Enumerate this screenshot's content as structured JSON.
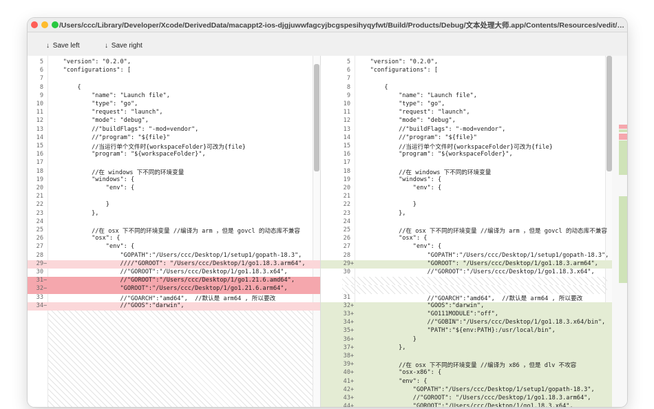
{
  "window": {
    "title": "/Users/ccc/Library/Developer/Xcode/DerivedData/macappt2-ios-djgjuwwfagcyjbcgspesihyqyfwt/Build/Products/Debug/文本处理大师.app/Contents/Resources/vedit/sample/ver1/launch.json..."
  },
  "toolbar": {
    "save_left_label": "Save left",
    "save_right_label": "Save right",
    "arrow_glyph": "↓"
  },
  "merge_arrow": "→",
  "colors": {
    "deleted": "#fbd7d9",
    "deleted_strong": "#f5a7ad",
    "added": "#e4ecd4",
    "minimap_red": "#f5a7ad",
    "minimap_green": "#cfe3b8"
  },
  "left_lines": [
    {
      "n": "5",
      "m": "",
      "t": "    \"version\": \"0.2.0\",",
      "s": ""
    },
    {
      "n": "6",
      "m": "",
      "t": "    \"configurations\": [",
      "s": ""
    },
    {
      "n": "7",
      "m": "",
      "t": "",
      "s": ""
    },
    {
      "n": "8",
      "m": "",
      "t": "        {",
      "s": ""
    },
    {
      "n": "9",
      "m": "",
      "t": "            \"name\": \"Launch file\",",
      "s": ""
    },
    {
      "n": "10",
      "m": "",
      "t": "            \"type\": \"go\",",
      "s": ""
    },
    {
      "n": "11",
      "m": "",
      "t": "            \"request\": \"launch\",",
      "s": ""
    },
    {
      "n": "12",
      "m": "",
      "t": "            \"mode\": \"debug\",",
      "s": ""
    },
    {
      "n": "13",
      "m": "",
      "t": "            //\"buildFlags\": \"-mod=vendor\",",
      "s": ""
    },
    {
      "n": "14",
      "m": "",
      "t": "            //\"program\": \"${file}\"",
      "s": ""
    },
    {
      "n": "15",
      "m": "",
      "t": "            //当运行单个文件时{workspaceFolder}可改为{file}",
      "s": ""
    },
    {
      "n": "16",
      "m": "",
      "t": "            \"program\": \"${workspaceFolder}\",",
      "s": ""
    },
    {
      "n": "17",
      "m": "",
      "t": "",
      "s": ""
    },
    {
      "n": "18",
      "m": "",
      "t": "            //在 windows 下不同的环境变量",
      "s": ""
    },
    {
      "n": "19",
      "m": "",
      "t": "            \"windows\": {",
      "s": ""
    },
    {
      "n": "20",
      "m": "",
      "t": "                \"env\": {",
      "s": ""
    },
    {
      "n": "21",
      "m": "",
      "t": "",
      "s": ""
    },
    {
      "n": "22",
      "m": "",
      "t": "                }",
      "s": ""
    },
    {
      "n": "23",
      "m": "",
      "t": "            },",
      "s": ""
    },
    {
      "n": "24",
      "m": "",
      "t": "",
      "s": ""
    },
    {
      "n": "25",
      "m": "",
      "t": "            //在 osx 下不同的环境变量 //编译为 arm ，但是 govcl 的动态库不兼容",
      "s": ""
    },
    {
      "n": "26",
      "m": "",
      "t": "            \"osx\": {",
      "s": ""
    },
    {
      "n": "27",
      "m": "",
      "t": "                \"env\": {",
      "s": ""
    },
    {
      "n": "28",
      "m": "",
      "t": "                    \"GOPATH\":\"/Users/ccc/Desktop/1/setup1/gopath-18.3\",",
      "s": ""
    },
    {
      "n": "29",
      "m": "−",
      "t": "                    ////\"GOROOT\": \"/Users/ccc/Desktop/1/go1.18.3.arm64\",",
      "s": "del"
    },
    {
      "n": "30",
      "m": "",
      "t": "                    //\"GOROOT\":\"/Users/ccc/Desktop/1/go1.18.3.x64\",",
      "s": ""
    },
    {
      "n": "31",
      "m": "−",
      "t": "                    //\"GOROOT\":\"/Users/ccc/Desktop/1/go1.21.6.amd64\",",
      "s": "delstrong"
    },
    {
      "n": "32",
      "m": "−",
      "t": "                    \"GOROOT\":\"/Users/ccc/Desktop/1/go1.21.6.arm64\",",
      "s": "delstrong"
    },
    {
      "n": "33",
      "m": "",
      "t": "                    //\"GOARCH\":\"amd64\",  //默认是 arm64 , 所以要改",
      "s": ""
    },
    {
      "n": "34",
      "m": "−",
      "t": "                    //\"GOOS\":\"darwin\",",
      "s": "del"
    }
  ],
  "right_lines": [
    {
      "n": "5",
      "m": "",
      "t": "    \"version\": \"0.2.0\",",
      "s": ""
    },
    {
      "n": "6",
      "m": "",
      "t": "    \"configurations\": [",
      "s": ""
    },
    {
      "n": "7",
      "m": "",
      "t": "",
      "s": ""
    },
    {
      "n": "8",
      "m": "",
      "t": "        {",
      "s": ""
    },
    {
      "n": "9",
      "m": "",
      "t": "            \"name\": \"Launch file\",",
      "s": ""
    },
    {
      "n": "10",
      "m": "",
      "t": "            \"type\": \"go\",",
      "s": ""
    },
    {
      "n": "11",
      "m": "",
      "t": "            \"request\": \"launch\",",
      "s": ""
    },
    {
      "n": "12",
      "m": "",
      "t": "            \"mode\": \"debug\",",
      "s": ""
    },
    {
      "n": "13",
      "m": "",
      "t": "            //\"buildFlags\": \"-mod=vendor\",",
      "s": ""
    },
    {
      "n": "14",
      "m": "",
      "t": "            //\"program\": \"${file}\"",
      "s": ""
    },
    {
      "n": "15",
      "m": "",
      "t": "            //当运行单个文件时{workspaceFolder}可改为{file}",
      "s": ""
    },
    {
      "n": "16",
      "m": "",
      "t": "            \"program\": \"${workspaceFolder}\",",
      "s": ""
    },
    {
      "n": "17",
      "m": "",
      "t": "",
      "s": ""
    },
    {
      "n": "18",
      "m": "",
      "t": "            //在 windows 下不同的环境变量",
      "s": ""
    },
    {
      "n": "19",
      "m": "",
      "t": "            \"windows\": {",
      "s": ""
    },
    {
      "n": "20",
      "m": "",
      "t": "                \"env\": {",
      "s": ""
    },
    {
      "n": "21",
      "m": "",
      "t": "",
      "s": ""
    },
    {
      "n": "22",
      "m": "",
      "t": "                }",
      "s": ""
    },
    {
      "n": "23",
      "m": "",
      "t": "            },",
      "s": ""
    },
    {
      "n": "24",
      "m": "",
      "t": "",
      "s": ""
    },
    {
      "n": "25",
      "m": "",
      "t": "            //在 osx 下不同的环境变量 //编译为 arm ，但是 govcl 的动态库不兼容",
      "s": ""
    },
    {
      "n": "26",
      "m": "",
      "t": "            \"osx\": {",
      "s": ""
    },
    {
      "n": "27",
      "m": "",
      "t": "                \"env\": {",
      "s": ""
    },
    {
      "n": "28",
      "m": "",
      "t": "                    \"GOPATH\":\"/Users/ccc/Desktop/1/setup1/gopath-18.3\",",
      "s": ""
    },
    {
      "n": "29",
      "m": "+",
      "t": "                    \"GOROOT\": \"/Users/ccc/Desktop/1/go1.18.3.arm64\",",
      "s": "add"
    },
    {
      "n": "30",
      "m": "",
      "t": "                    //\"GOROOT\":\"/Users/ccc/Desktop/1/go1.18.3.x64\",",
      "s": ""
    },
    {
      "n": "",
      "m": "",
      "t": "",
      "s": "gap"
    },
    {
      "n": "",
      "m": "",
      "t": "",
      "s": "gap"
    },
    {
      "n": "31",
      "m": "",
      "t": "                    //\"GOARCH\":\"amd64\",  //默认是 arm64 , 所以要改",
      "s": ""
    },
    {
      "n": "32",
      "m": "+",
      "t": "                    \"GOOS\":\"darwin\",",
      "s": "add"
    },
    {
      "n": "33",
      "m": "+",
      "t": "                    \"GO111MODULE\":\"off\",",
      "s": "add"
    },
    {
      "n": "34",
      "m": "+",
      "t": "                    //\"GOBIN\":\"/Users/ccc/Desktop/1/go1.18.3.x64/bin\",",
      "s": "add"
    },
    {
      "n": "35",
      "m": "+",
      "t": "                    \"PATH\":\"${env:PATH}:/usr/local/bin\",",
      "s": "add"
    },
    {
      "n": "36",
      "m": "+",
      "t": "                }",
      "s": "add"
    },
    {
      "n": "37",
      "m": "+",
      "t": "            },",
      "s": "add"
    },
    {
      "n": "38",
      "m": "+",
      "t": "",
      "s": "add"
    },
    {
      "n": "39",
      "m": "+",
      "t": "            //在 osx 下不同的环境变量 //编译为 x86 ，但是 dlv 不攻容",
      "s": "add"
    },
    {
      "n": "40",
      "m": "+",
      "t": "            \"osx-x86\": {",
      "s": "add"
    },
    {
      "n": "41",
      "m": "+",
      "t": "            \"env\": {",
      "s": "add"
    },
    {
      "n": "42",
      "m": "+",
      "t": "                \"GOPATH\":\"/Users/ccc/Desktop/1/setup1/gopath-18.3\",",
      "s": "add"
    },
    {
      "n": "43",
      "m": "+",
      "t": "                //\"GOROOT\": \"/Users/ccc/Desktop/1/go1.18.3.arm64\",",
      "s": "add"
    },
    {
      "n": "44",
      "m": "+",
      "t": "                \"GOROOT\":\"/Users/ccc/Desktop/1/go1.18.3.x64\",",
      "s": "add"
    }
  ]
}
